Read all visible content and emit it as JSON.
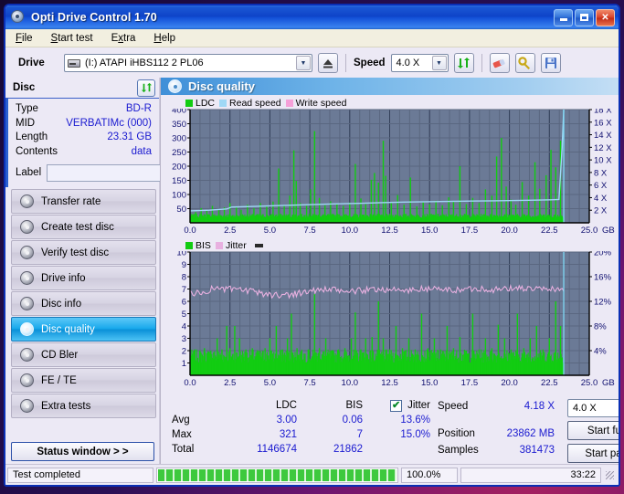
{
  "window": {
    "title": "Opti Drive Control 1.70",
    "title_icon": "disc-icon",
    "minimize": "_",
    "maximize": "□",
    "close": "✕"
  },
  "menu": [
    {
      "label": "File",
      "accel": "F"
    },
    {
      "label": "Start test",
      "accel": "S"
    },
    {
      "label": "Extra",
      "accel": "x"
    },
    {
      "label": "Help",
      "accel": "H"
    }
  ],
  "toolbar": {
    "drive_label": "Drive",
    "drive_value": "(I:)  ATAPI iHBS112  2 PL06",
    "speed_label": "Speed",
    "speed_value": "4.0 X",
    "eject_icon": "eject-icon",
    "refresh_icon": "refresh-icon",
    "erase_icon": "eraser-icon",
    "settings_icon": "settings-icon",
    "save_icon": "save-icon"
  },
  "sidebar": {
    "disc_header": "Disc",
    "refresh_icon": "refresh-icon",
    "info": [
      {
        "key": "Type",
        "value": "BD-R"
      },
      {
        "key": "MID",
        "value": "VERBATIMc (000)"
      },
      {
        "key": "Length",
        "value": "23.31 GB"
      },
      {
        "key": "Contents",
        "value": "data"
      }
    ],
    "label_key": "Label",
    "label_value": "",
    "disc_button_icon": "cd-icon",
    "items": [
      {
        "label": "Transfer rate",
        "active": false
      },
      {
        "label": "Create test disc",
        "active": false
      },
      {
        "label": "Verify test disc",
        "active": false
      },
      {
        "label": "Drive info",
        "active": false
      },
      {
        "label": "Disc info",
        "active": false
      },
      {
        "label": "Disc quality",
        "active": true
      },
      {
        "label": "CD Bler",
        "active": false
      },
      {
        "label": "FE / TE",
        "active": false
      },
      {
        "label": "Extra tests",
        "active": false
      }
    ],
    "status_window_button": "Status window > >"
  },
  "main": {
    "header_title": "Disc quality",
    "header_icon": "disc-quality-icon"
  },
  "stats": {
    "col_ldc": "LDC",
    "col_bis": "BIS",
    "col_jitter": "Jitter",
    "jitter_checked": "✔",
    "rows": [
      {
        "label": "Avg",
        "ldc": "3.00",
        "bis": "0.06",
        "jitter": "13.6%"
      },
      {
        "label": "Max",
        "ldc": "321",
        "bis": "7",
        "jitter": "15.0%"
      },
      {
        "label": "Total",
        "ldc": "1146674",
        "bis": "21862",
        "jitter": ""
      }
    ],
    "speed_key": "Speed",
    "speed_value": "4.18 X",
    "position_key": "Position",
    "position_value": "23862 MB",
    "samples_key": "Samples",
    "samples_value": "381473",
    "speed_select": "4.0 X",
    "start_full": "Start full",
    "start_part": "Start part"
  },
  "statusbar": {
    "text": "Test completed",
    "percent": "100.0%",
    "time": "33:22",
    "progress_value": 100
  },
  "colors": {
    "ldc": "#12cc12",
    "bis": "#12cc12",
    "read_speed": "#9fd8f5",
    "write_speed": "#f5a0d8",
    "jitter": "#e8b0e0",
    "plot_bg": "#6b7a96",
    "grid": "#4e5a72",
    "end_marker": "#7fd8f5",
    "accent": "#1a1ad0"
  },
  "chart_data": [
    {
      "type": "area",
      "name": "disc-quality-ldc-chart",
      "title": "",
      "xlabel": "GB",
      "x_ticks": [
        "0.0",
        "2.5",
        "5.0",
        "7.5",
        "10.0",
        "12.5",
        "15.0",
        "17.5",
        "20.0",
        "22.5",
        "25.0"
      ],
      "xlim": [
        0,
        25
      ],
      "ylabel_left": "LDC",
      "y_ticks_left": [
        "50",
        "100",
        "150",
        "200",
        "250",
        "300",
        "350",
        "400"
      ],
      "ylim_left": [
        0,
        400
      ],
      "ylabel_right": "Speed",
      "y_ticks_right": [
        "2 X",
        "4 X",
        "6 X",
        "8 X",
        "10 X",
        "12 X",
        "14 X",
        "16 X",
        "18 X"
      ],
      "ylim_right": [
        0,
        18
      ],
      "grid": true,
      "legend": [
        {
          "name": "LDC",
          "color": "#12cc12"
        },
        {
          "name": "Read speed",
          "color": "#9fd8f5"
        },
        {
          "name": "Write speed",
          "color": "#f5a0d8"
        }
      ],
      "data_end_gb": 23.4,
      "series": [
        {
          "name": "LDC",
          "type": "spikes",
          "baseline": 18,
          "noise": 14,
          "spikes": [
            [
              0.35,
              38
            ],
            [
              0.7,
              52
            ],
            [
              1.05,
              44
            ],
            [
              1.4,
              60
            ],
            [
              1.8,
              48
            ],
            [
              2.15,
              55
            ],
            [
              2.5,
              70
            ],
            [
              2.9,
              58
            ],
            [
              3.2,
              46
            ],
            [
              3.6,
              64
            ],
            [
              4.0,
              52
            ],
            [
              4.4,
              70
            ],
            [
              4.8,
              58
            ],
            [
              5.2,
              75
            ],
            [
              5.55,
              192
            ],
            [
              5.9,
              62
            ],
            [
              6.25,
              96
            ],
            [
              6.5,
              256
            ],
            [
              6.65,
              148
            ],
            [
              6.9,
              70
            ],
            [
              7.3,
              60
            ],
            [
              7.55,
              118
            ],
            [
              7.8,
              324
            ],
            [
              8.1,
              88
            ],
            [
              8.45,
              62
            ],
            [
              8.8,
              76
            ],
            [
              9.2,
              68
            ],
            [
              9.6,
              60
            ],
            [
              10.0,
              72
            ],
            [
              10.35,
              208
            ],
            [
              10.7,
              86
            ],
            [
              11.0,
              66
            ],
            [
              11.35,
              152
            ],
            [
              11.55,
              176
            ],
            [
              11.8,
              142
            ],
            [
              12.1,
              290
            ],
            [
              12.25,
              166
            ],
            [
              12.6,
              70
            ],
            [
              13.0,
              98
            ],
            [
              13.4,
              64
            ],
            [
              13.8,
              160
            ],
            [
              14.2,
              58
            ],
            [
              14.6,
              72
            ],
            [
              15.0,
              66
            ],
            [
              15.4,
              78
            ],
            [
              15.8,
              62
            ],
            [
              16.2,
              90
            ],
            [
              16.5,
              74
            ],
            [
              16.9,
              200
            ],
            [
              17.3,
              66
            ],
            [
              17.7,
              88
            ],
            [
              18.1,
              70
            ],
            [
              18.5,
              118
            ],
            [
              18.9,
              96
            ],
            [
              19.2,
              234
            ],
            [
              19.5,
              300
            ],
            [
              19.8,
              128
            ],
            [
              20.1,
              82
            ],
            [
              20.4,
              64
            ],
            [
              20.8,
              144
            ],
            [
              21.2,
              96
            ],
            [
              21.6,
              214
            ],
            [
              21.9,
              120
            ],
            [
              22.3,
              168
            ],
            [
              22.6,
              258
            ],
            [
              22.9,
              196
            ],
            [
              23.2,
              290
            ]
          ]
        },
        {
          "name": "Read speed",
          "type": "line",
          "color": "#9fd8f5",
          "points": [
            [
              0.0,
              1.9
            ],
            [
              1.2,
              2.0
            ],
            [
              2.3,
              2.2
            ],
            [
              2.6,
              2.5
            ],
            [
              4.0,
              2.6
            ],
            [
              5.0,
              2.7
            ],
            [
              6.4,
              2.8
            ],
            [
              7.6,
              2.9
            ],
            [
              9.0,
              3.0
            ],
            [
              10.6,
              3.1
            ],
            [
              12.0,
              3.2
            ],
            [
              13.4,
              3.3
            ],
            [
              14.8,
              3.35
            ],
            [
              16.2,
              3.4
            ],
            [
              17.6,
              3.45
            ],
            [
              19.0,
              3.5
            ],
            [
              20.4,
              3.55
            ],
            [
              21.6,
              3.6
            ],
            [
              22.6,
              3.65
            ],
            [
              23.1,
              3.7
            ],
            [
              23.3,
              12.0
            ],
            [
              23.4,
              18.0
            ]
          ]
        }
      ]
    },
    {
      "type": "area",
      "name": "disc-quality-bis-chart",
      "title": "",
      "xlabel": "GB",
      "x_ticks": [
        "0.0",
        "2.5",
        "5.0",
        "7.5",
        "10.0",
        "12.5",
        "15.0",
        "17.5",
        "20.0",
        "22.5",
        "25.0"
      ],
      "xlim": [
        0,
        25
      ],
      "ylabel_left": "BIS",
      "y_ticks_left": [
        "1",
        "2",
        "3",
        "4",
        "5",
        "6",
        "7",
        "8",
        "9",
        "10"
      ],
      "ylim_left": [
        0,
        10
      ],
      "ylabel_right": "Jitter",
      "y_ticks_right": [
        "4%",
        "8%",
        "12%",
        "16%",
        "20%"
      ],
      "ylim_right": [
        0,
        20
      ],
      "grid": true,
      "legend": [
        {
          "name": "BIS",
          "color": "#12cc12"
        },
        {
          "name": "Jitter",
          "color": "#e8b0e0"
        }
      ],
      "data_end_gb": 23.4,
      "series": [
        {
          "name": "BIS",
          "type": "spikes",
          "baseline": 1.0,
          "noise": 1.1,
          "spikes": [
            [
              0.3,
              2.1
            ],
            [
              0.6,
              2.0
            ],
            [
              0.9,
              2.2
            ],
            [
              1.3,
              2.0
            ],
            [
              1.7,
              3.0
            ],
            [
              2.0,
              2.1
            ],
            [
              2.3,
              4.0
            ],
            [
              2.5,
              2.2
            ],
            [
              2.8,
              4.0
            ],
            [
              3.1,
              3.0
            ],
            [
              3.5,
              2.1
            ],
            [
              3.9,
              2.2
            ],
            [
              4.3,
              2.0
            ],
            [
              4.7,
              2.2
            ],
            [
              5.0,
              3.0
            ],
            [
              5.4,
              4.0
            ],
            [
              5.8,
              2.1
            ],
            [
              6.1,
              3.0
            ],
            [
              6.35,
              5.0
            ],
            [
              6.7,
              2.2
            ],
            [
              7.0,
              2.0
            ],
            [
              7.4,
              2.1
            ],
            [
              7.8,
              6.6
            ],
            [
              8.1,
              2.2
            ],
            [
              8.5,
              3.0
            ],
            [
              8.9,
              2.0
            ],
            [
              9.3,
              2.1
            ],
            [
              9.7,
              2.2
            ],
            [
              10.1,
              3.0
            ],
            [
              10.35,
              5.1
            ],
            [
              10.7,
              2.1
            ],
            [
              11.0,
              3.0
            ],
            [
              11.4,
              3.1
            ],
            [
              11.8,
              6.0
            ],
            [
              12.1,
              3.0
            ],
            [
              12.5,
              2.1
            ],
            [
              12.9,
              4.0
            ],
            [
              13.3,
              2.2
            ],
            [
              13.7,
              3.0
            ],
            [
              14.1,
              2.1
            ],
            [
              14.5,
              5.0
            ],
            [
              14.9,
              2.2
            ],
            [
              15.3,
              3.0
            ],
            [
              15.7,
              2.1
            ],
            [
              16.1,
              4.0
            ],
            [
              16.5,
              2.2
            ],
            [
              16.9,
              3.1
            ],
            [
              17.3,
              2.0
            ],
            [
              17.7,
              5.0
            ],
            [
              18.1,
              2.1
            ],
            [
              18.5,
              3.0
            ],
            [
              18.9,
              2.2
            ],
            [
              19.3,
              4.1
            ],
            [
              19.7,
              3.0
            ],
            [
              20.1,
              2.1
            ],
            [
              20.5,
              5.0
            ],
            [
              20.9,
              2.2
            ],
            [
              21.3,
              3.0
            ],
            [
              21.7,
              4.0
            ],
            [
              22.1,
              2.1
            ],
            [
              22.5,
              3.0
            ],
            [
              22.9,
              6.0
            ],
            [
              23.2,
              4.0
            ]
          ]
        },
        {
          "name": "Jitter",
          "type": "noisy-line",
          "color": "#e8b0e0",
          "avg_percent": 13.6,
          "max_percent": 15.0,
          "points": [
            [
              0.0,
              13.4
            ],
            [
              0.8,
              13.3
            ],
            [
              1.5,
              14.2
            ],
            [
              2.2,
              14.0
            ],
            [
              3.0,
              13.9
            ],
            [
              3.8,
              13.6
            ],
            [
              4.6,
              13.2
            ],
            [
              5.4,
              13.0
            ],
            [
              6.2,
              13.1
            ],
            [
              7.0,
              13.4
            ],
            [
              7.8,
              13.8
            ],
            [
              8.6,
              13.9
            ],
            [
              9.4,
              13.7
            ],
            [
              10.2,
              13.6
            ],
            [
              11.0,
              13.8
            ],
            [
              11.8,
              14.0
            ],
            [
              12.6,
              13.9
            ],
            [
              13.4,
              13.7
            ],
            [
              14.2,
              13.9
            ],
            [
              15.0,
              14.1
            ],
            [
              15.8,
              13.9
            ],
            [
              16.6,
              13.8
            ],
            [
              17.4,
              14.0
            ],
            [
              18.2,
              14.1
            ],
            [
              19.0,
              13.9
            ],
            [
              19.8,
              14.0
            ],
            [
              20.6,
              14.2
            ],
            [
              21.4,
              14.0
            ],
            [
              22.2,
              13.9
            ],
            [
              23.0,
              14.1
            ],
            [
              23.4,
              13.8
            ]
          ]
        }
      ]
    }
  ]
}
